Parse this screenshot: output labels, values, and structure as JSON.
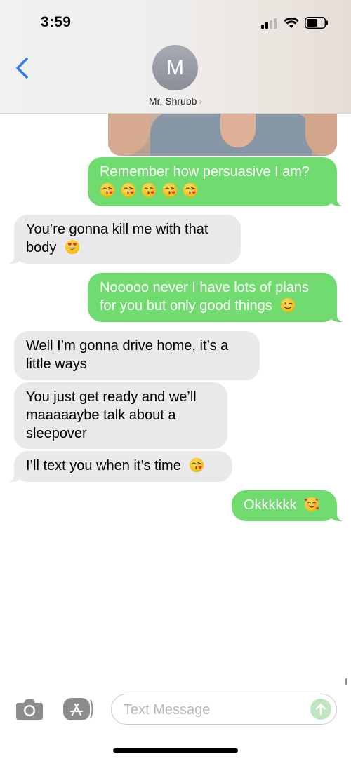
{
  "status_bar": {
    "time": "3:59"
  },
  "header": {
    "avatar_initial": "M",
    "contact_name": "Mr. Shrubb",
    "chevron": "›"
  },
  "messages": [
    {
      "direction": "outgoing",
      "line1": "Remember how persuasive I am?",
      "emoji": [
        "kissing-heart",
        "kissing-heart",
        "kissing-heart",
        "kissing-heart",
        "kissing-heart"
      ]
    },
    {
      "direction": "incoming",
      "line1": "You’re gonna kill me with that",
      "line2": "body",
      "emoji": [
        "heart-eyes"
      ]
    },
    {
      "direction": "outgoing",
      "line1": "Nooooo never I have lots of plans",
      "line2": "for you but only good things",
      "emoji": [
        "wink"
      ]
    },
    {
      "direction": "incoming",
      "line1": "Well I’m gonna drive home, it’s a",
      "line2": "little ways"
    },
    {
      "direction": "incoming",
      "line1": "You just get ready and we’ll",
      "line2": "maaaaaybe talk about a",
      "line3": "sleepover"
    },
    {
      "direction": "incoming",
      "line1": "I’ll text you when it’s time",
      "emoji": [
        "kissing-heart"
      ]
    },
    {
      "direction": "outgoing",
      "line1": "Okkkkkk",
      "emoji": [
        "smiling-hearts"
      ]
    }
  ],
  "input_bar": {
    "placeholder": "Text Message",
    "camera_icon": "camera-icon",
    "apps_icon": "app-store-icon",
    "send_icon": "arrow-up-icon"
  },
  "colors": {
    "outgoing_bubble": "#70dc6f",
    "incoming_bubble": "#e9e9eb",
    "accent_blue": "#2f7cf6"
  }
}
